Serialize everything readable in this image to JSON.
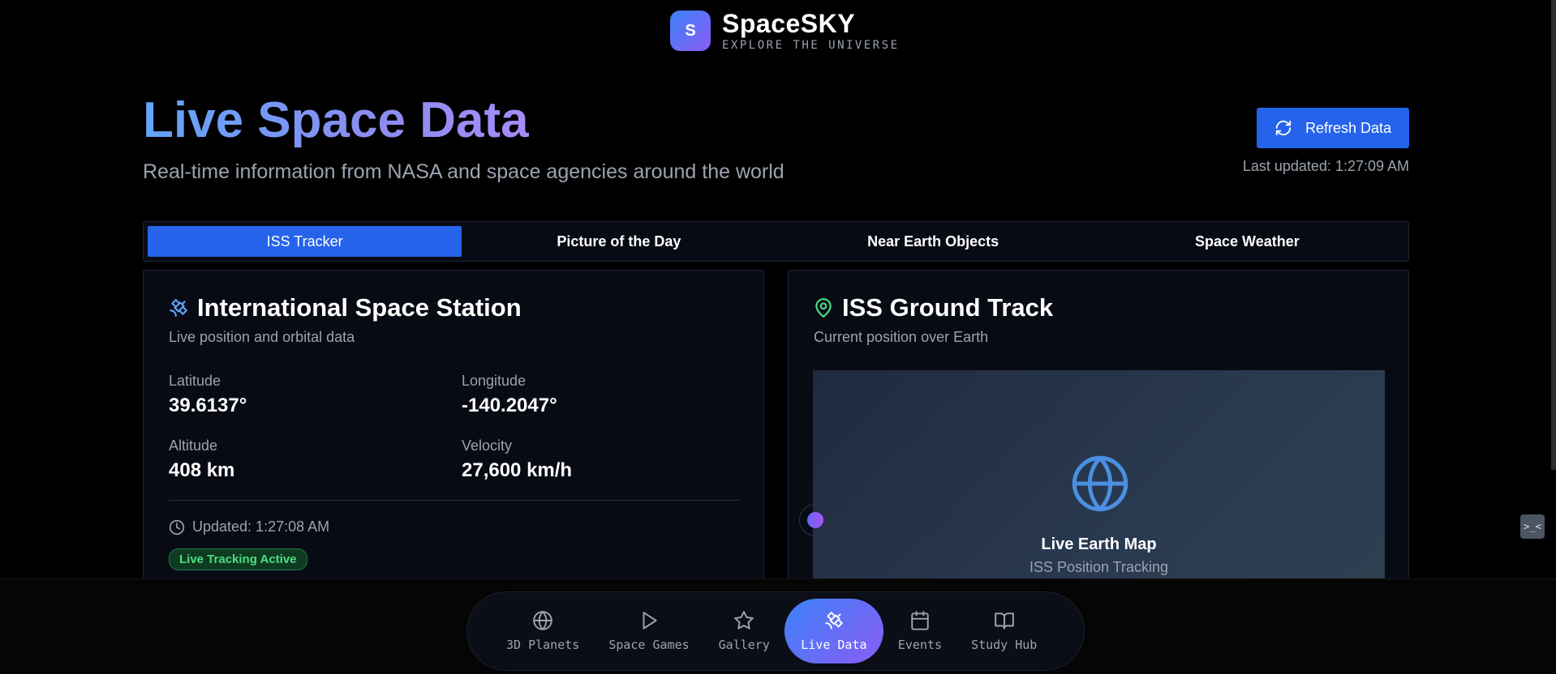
{
  "brand": {
    "logo_letter": "S",
    "name": "SpaceSKY",
    "tagline": "EXPLORE THE UNIVERSE"
  },
  "hero": {
    "title": "Live Space Data",
    "subtitle": "Real-time information from NASA and space agencies around the world",
    "refresh_label": "Refresh Data",
    "last_updated": "Last updated: 1:27:09 AM"
  },
  "tabs": [
    {
      "label": "ISS Tracker",
      "active": true
    },
    {
      "label": "Picture of the Day",
      "active": false
    },
    {
      "label": "Near Earth Objects",
      "active": false
    },
    {
      "label": "Space Weather",
      "active": false
    }
  ],
  "iss_card": {
    "title": "International Space Station",
    "description": "Live position and orbital data",
    "stats": {
      "latitude": {
        "label": "Latitude",
        "value": "39.6137°"
      },
      "longitude": {
        "label": "Longitude",
        "value": "-140.2047°"
      },
      "altitude": {
        "label": "Altitude",
        "value": "408 km"
      },
      "velocity": {
        "label": "Velocity",
        "value": "27,600 km/h"
      }
    },
    "updated": "Updated: 1:27:08 AM",
    "badge": "Live Tracking Active"
  },
  "track_card": {
    "title": "ISS Ground Track",
    "description": "Current position over Earth",
    "map_title": "Live Earth Map",
    "map_subtitle": "ISS Position Tracking"
  },
  "widget": {
    "label": ">_<"
  },
  "nav": [
    {
      "label": "3D Planets",
      "icon": "globe-icon",
      "active": false
    },
    {
      "label": "Space Games",
      "icon": "play-icon",
      "active": false
    },
    {
      "label": "Gallery",
      "icon": "star-icon",
      "active": false
    },
    {
      "label": "Live Data",
      "icon": "satellite-icon",
      "active": true
    },
    {
      "label": "Events",
      "icon": "calendar-icon",
      "active": false
    },
    {
      "label": "Study Hub",
      "icon": "book-icon",
      "active": false
    }
  ],
  "colors": {
    "accent": "#2563eb",
    "gradient_start": "#3b82f6",
    "gradient_end": "#8b5cf6",
    "live_green": "#4ade80",
    "card_bg": "#080b14"
  }
}
